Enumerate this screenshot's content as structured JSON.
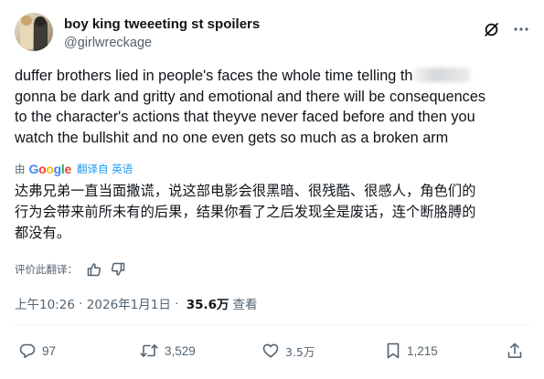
{
  "author": {
    "display_name": "boy king tweeeting st spoilers",
    "handle": "@girlwreckage"
  },
  "header_icons": [
    "grok-slash-icon",
    "more-icon"
  ],
  "tweet": {
    "lines": [
      "duffer brothers lied in people's faces the whole time telling th",
      "gonna be dark and gritty and emotional and there will be consequences",
      "to the character's actions that theyve never faced before and then you",
      "watch the bullshit and no one even gets so much as a broken arm"
    ]
  },
  "translation": {
    "by_label": "由",
    "google_logo": [
      "G",
      "o",
      "o",
      "g",
      "l",
      "e"
    ],
    "google_colors": [
      "#4285F4",
      "#EA4335",
      "#FBBC05",
      "#4285F4",
      "#34A853",
      "#EA4335"
    ],
    "link_label": "翻译自 英语",
    "lines": [
      "达弗兄弟一直当面撒谎，说这部电影会很黑暗、很残酷、很感人，角色们的",
      "行为会带来前所未有的后果，结果你看了之后发现全是废话，连个断胳膊的",
      "都没有。"
    ]
  },
  "rate_label": "评价此翻译：",
  "meta": {
    "time": "上午10:26",
    "separator": " · ",
    "date": "2026年1月1日",
    "separator2": " · ",
    "views_count": "35.6万",
    "views_label": "查看"
  },
  "actions": {
    "replies": "97",
    "retweets": "3,529",
    "likes": "3.5万",
    "bookmarks": "1,215"
  },
  "colors": {
    "text": "#0f1419",
    "secondary": "#536471",
    "link": "#1d9bf0",
    "divider": "#eff3f4"
  }
}
